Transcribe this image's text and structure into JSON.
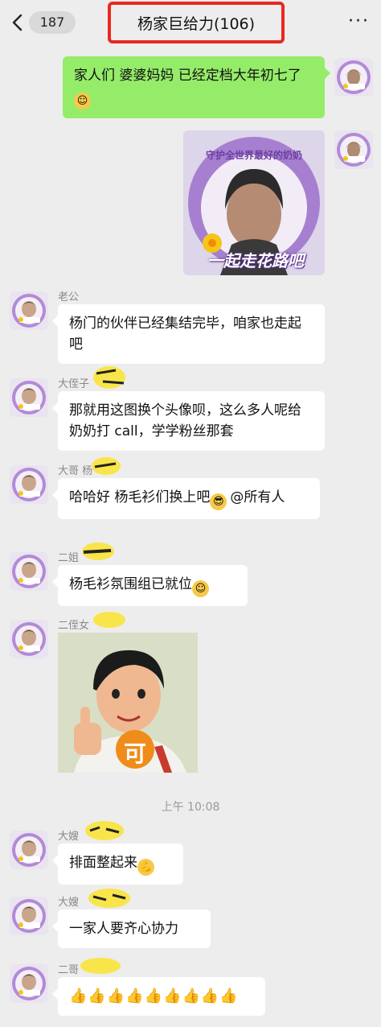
{
  "header": {
    "back_count": "187",
    "title": "杨家巨给力(106)",
    "more": "···"
  },
  "avatar": {
    "badge_text": "守护全世界最好的奶奶",
    "slogan": "一起走花路吧"
  },
  "messages": [
    {
      "side": "right",
      "text": "家人们  婆婆妈妈 已经定档大年初七了"
    },
    {
      "side": "right",
      "type": "image",
      "caption": "守护全世界最好的奶奶",
      "slogan": "一起走花路吧"
    },
    {
      "side": "left",
      "name": "老公",
      "text": "杨门的伙伴已经集结完毕，咱家也走起吧"
    },
    {
      "side": "left",
      "name": "大侄子",
      "text": "那就用这图换个头像呗，这么多人呢给奶奶打 call，学学粉丝那套"
    },
    {
      "side": "left",
      "name": "大哥 杨",
      "text": "哈哈好 杨毛衫们换上吧",
      "mention": "@所有人"
    },
    {
      "side": "left",
      "name": "二姐",
      "text": "杨毛衫氛围组已就位"
    },
    {
      "side": "left",
      "name": "二侄女",
      "type": "image",
      "sticker_text": "可"
    },
    {
      "side": "left",
      "name": "大嫂",
      "text": "排面整起来"
    },
    {
      "side": "left",
      "name": "大嫂",
      "text": "一家人要齐心协力"
    },
    {
      "side": "left",
      "name": "二哥",
      "text": "👍👍👍👍👍👍👍👍👍"
    }
  ],
  "timestamp": "上午 10:08",
  "colors": {
    "accent_green": "#95ec69",
    "highlight_red": "#e8281e",
    "avatar_purple": "#b28ad6"
  }
}
